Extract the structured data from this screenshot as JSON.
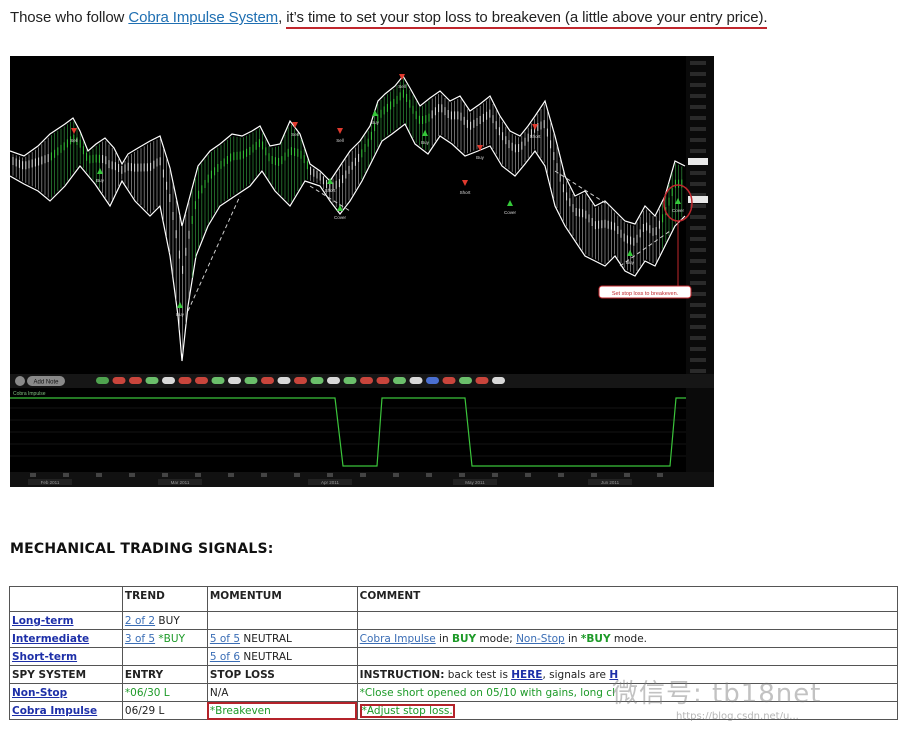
{
  "intro": {
    "prefix": "Those who follow ",
    "link": "Cobra Impulse System",
    "comma": ", ",
    "highlight": "it’s time to set your stop loss to breakeven (a little above your entry price)."
  },
  "chart": {
    "button_label": "Add Note",
    "annotation": "Set stop loss to breakeven.",
    "indicator_label": "Cobra Impulse",
    "signals": [
      "Sell",
      "Buy",
      "Sell",
      "Cover",
      "Short",
      "Sell",
      "Buy",
      "Short",
      "Cover",
      "Buy",
      "Sell",
      "Short",
      "Buy",
      "Buy",
      "Cover",
      "Buy"
    ],
    "axis_dates": [
      "Feb 2011",
      "Mar 2011",
      "Apr 2011",
      "May 2011",
      "Jun 2011"
    ],
    "colors": {
      "background": "#000000",
      "price": "#ffffff",
      "buy": "#35c93a",
      "sell": "#e03a2e",
      "indicator": "#3bc43b",
      "annotation": "#c0272d"
    }
  },
  "section_title": "MECHANICAL TRADING SIGNALS:",
  "table": {
    "headers": [
      "",
      "TREND",
      "MOMENTUM",
      "COMMENT"
    ],
    "rows": {
      "long": {
        "label": "Long-term",
        "trend_link": "2 of 2",
        "trend_text": " BUY"
      },
      "inter": {
        "label": "Intermediate",
        "trend_link": "3 of 5",
        "trend_text": " *BUY",
        "mom_link": "5 of 5",
        "mom_text": " NEUTRAL",
        "c1": "Cobra Impulse",
        "c2": " in ",
        "c3": "BUY",
        "c4": " mode; ",
        "c5": "Non-Stop",
        "c6": " in ",
        "c7": "*BUY",
        "c8": " mode."
      },
      "short": {
        "label": "Short-term",
        "mom_link": "5 of 6",
        "mom_text": " NEUTRAL"
      },
      "spy": {
        "c0": "SPY SYSTEM",
        "c1": "ENTRY",
        "c2": "STOP LOSS",
        "c3a": "INSTRUCTION:",
        "c3b": " back test is ",
        "c3c": "HERE",
        "c3d": ", signals are ",
        "c3e": "H"
      },
      "nonstop": {
        "label": "Non-Stop",
        "entry": "*06/30 L",
        "stop": "N/A",
        "comment": "*Close short opened on 05/10 with gains, long cl"
      },
      "cobra": {
        "label": "Cobra Impulse",
        "entry": "06/29 L",
        "stop": "*Breakeven",
        "comment": "*Adjust stop loss."
      }
    }
  },
  "watermark": {
    "text": "微信号: tb18net",
    "sub": "https://blog.csdn.net/u..."
  }
}
